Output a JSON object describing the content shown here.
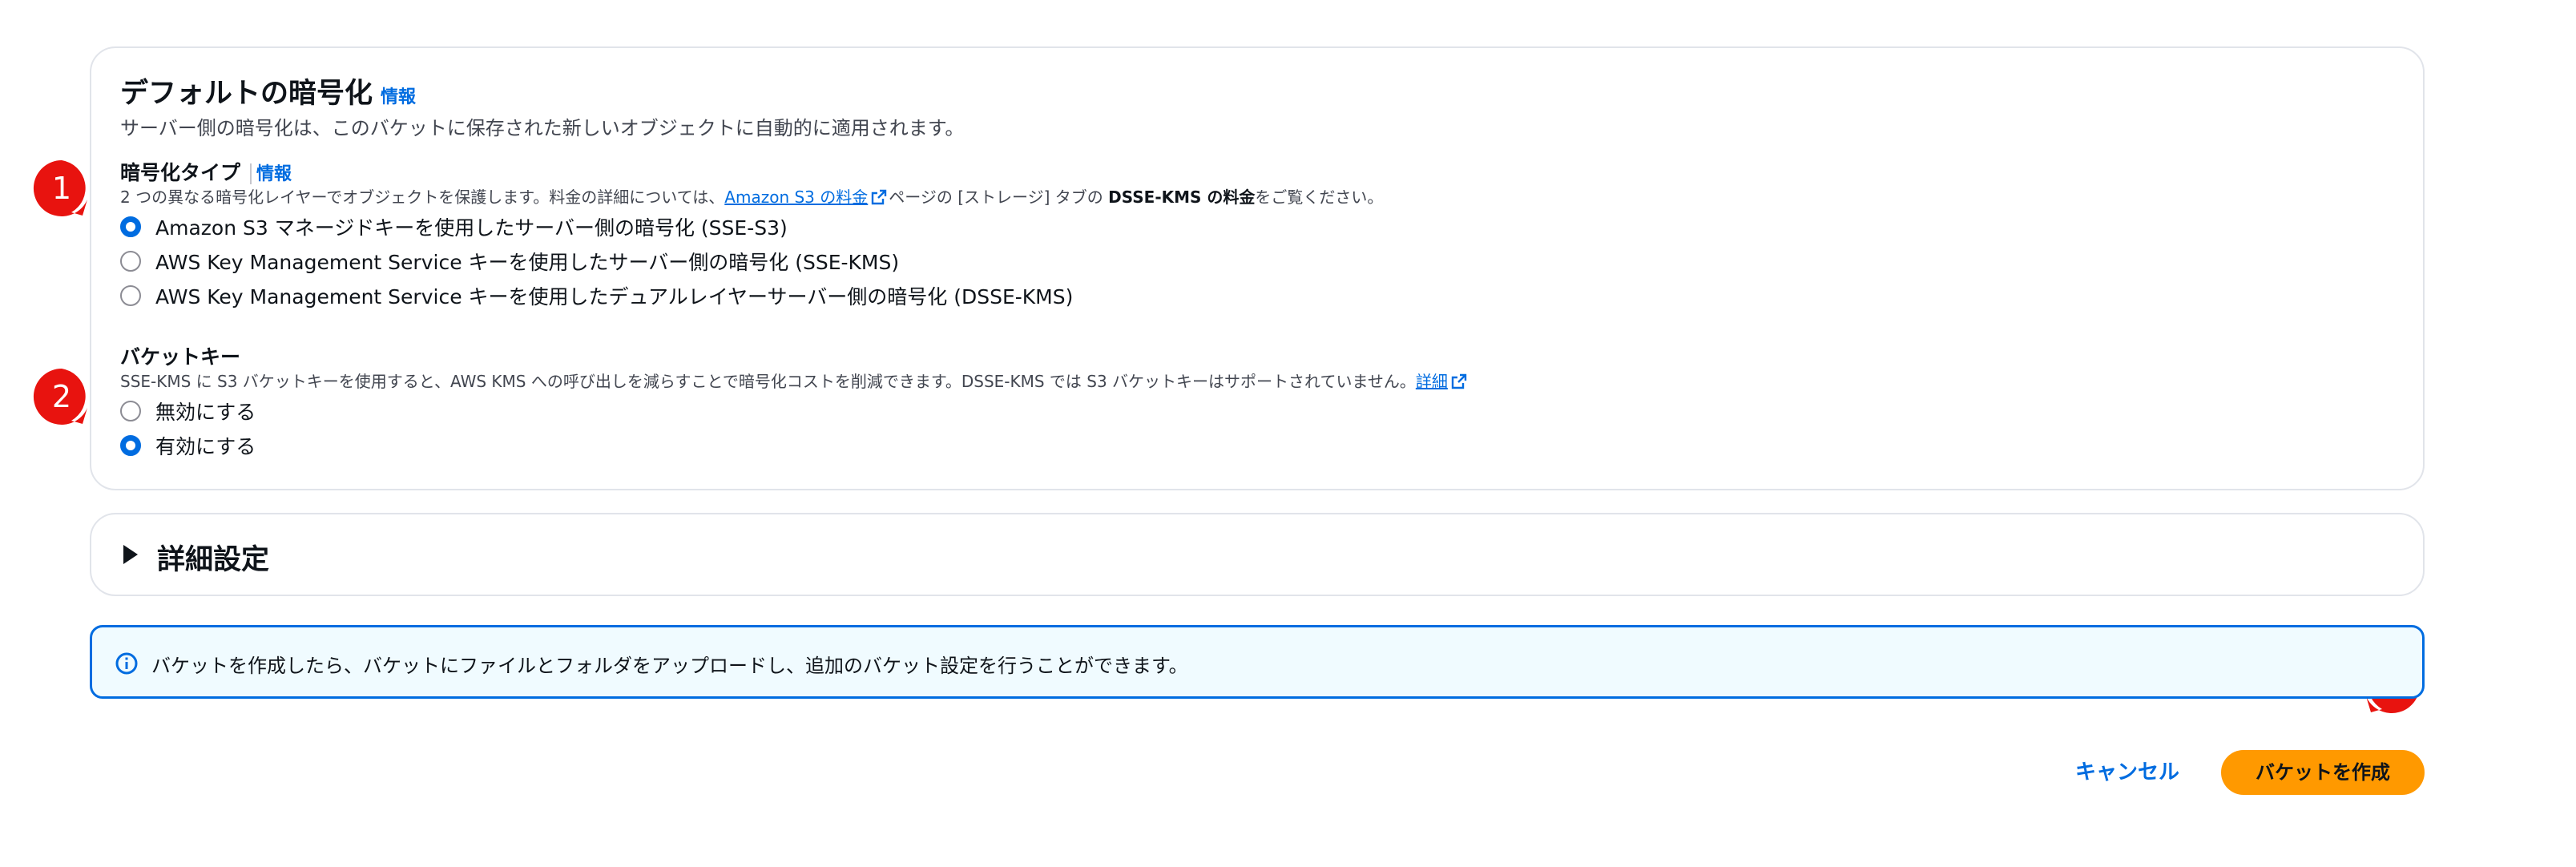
{
  "encryption": {
    "title": "デフォルトの暗号化",
    "info": "情報",
    "description": "サーバー側の暗号化は、このバケットに保存された新しいオブジェクトに自動的に適用されます。",
    "type_label": "暗号化タイプ",
    "type_info": "情報",
    "type_desc_pre": "2 つの異なる暗号化レイヤーでオブジェクトを保護します。料金の詳細については、",
    "type_desc_link": "Amazon S3 の料金",
    "type_desc_mid": "ページの [ストレージ] タブの ",
    "type_desc_bold": "DSSE-KMS の料金",
    "type_desc_post": "をご覧ください。",
    "options": [
      {
        "label": "Amazon S3 マネージドキーを使用したサーバー側の暗号化 (SSE-S3)",
        "checked": true
      },
      {
        "label": "AWS Key Management Service キーを使用したサーバー側の暗号化 (SSE-KMS)",
        "checked": false
      },
      {
        "label": "AWS Key Management Service キーを使用したデュアルレイヤーサーバー側の暗号化 (DSSE-KMS)",
        "checked": false
      }
    ]
  },
  "bucket_key": {
    "label": "バケットキー",
    "desc": "SSE-KMS に S3 バケットキーを使用すると、AWS KMS への呼び出しを減らすことで暗号化コストを削減できます。DSSE-KMS では S3 バケットキーはサポートされていません。",
    "desc_link": "詳細",
    "options": [
      {
        "label": "無効にする",
        "checked": false
      },
      {
        "label": "有効にする",
        "checked": true
      }
    ]
  },
  "advanced": {
    "title": "詳細設定"
  },
  "alert": {
    "text": "バケットを作成したら、バケットにファイルとフォルダをアップロードし、追加のバケット設定を行うことができます。"
  },
  "actions": {
    "cancel": "キャンセル",
    "create": "バケットを作成"
  },
  "markers": [
    "1",
    "2",
    "3"
  ],
  "colors": {
    "accent": "#006ce0",
    "primary_button": "#ff9900",
    "marker": "#e8130f",
    "alert_bg": "#f0fbff"
  }
}
